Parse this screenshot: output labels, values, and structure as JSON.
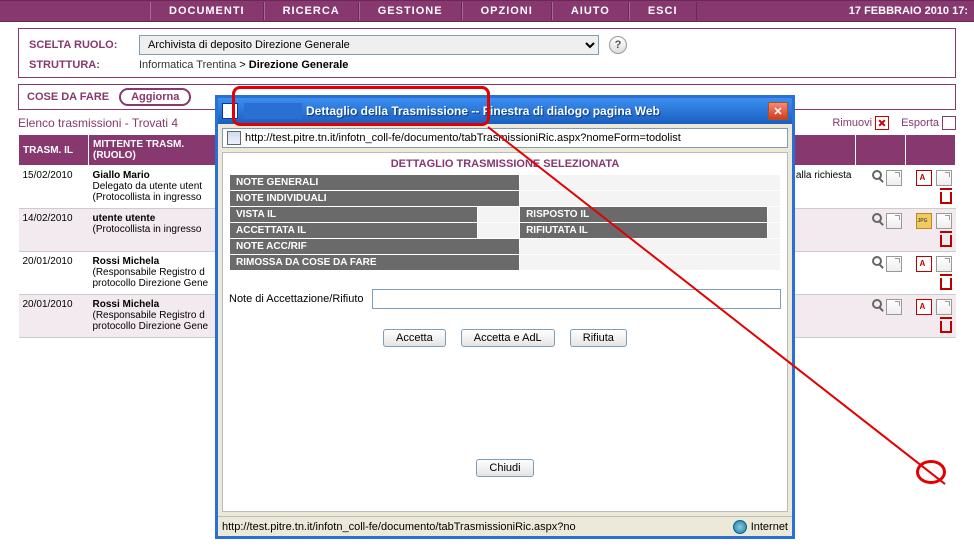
{
  "menu": {
    "items": [
      "DOCUMENTI",
      "RICERCA",
      "GESTIONE",
      "OPZIONI",
      "AIUTO",
      "ESCI"
    ],
    "date": "17 FEBBRAIO 2010 17:"
  },
  "role_panel": {
    "label_scelta": "SCELTA RUOLO:",
    "selected_role": "Archivista di deposito Direzione Generale",
    "label_struttura": "STRUTTURA:",
    "breadcrumb": {
      "item1": "Informatica Trentina",
      "sep": " > ",
      "item2": "Direzione Generale"
    },
    "help": "?"
  },
  "todo": {
    "label": "COSE DA FARE",
    "button": "Aggiorna"
  },
  "list": {
    "title": "Elenco trasmissioni - Trovati 4",
    "action_rimuovi": "Rimuovi",
    "action_esporta": "Esporta",
    "col_trasm": "TRASM. IL",
    "col_mittente": "MITTENTE TRASM. (RUOLO)"
  },
  "rows": [
    {
      "date": "15/02/2010",
      "mitt_name": "Giallo Mario",
      "mitt_role1": "Delegato da utente utent",
      "mitt_role2": "(Protocollista in ingresso",
      "rightnote": "uito alla richiesta"
    },
    {
      "date": "14/02/2010",
      "mitt_name": "utente utente",
      "mitt_role1": "(Protocollista in ingresso",
      "mitt_role2": ""
    },
    {
      "date": "20/01/2010",
      "mitt_name": "Rossi Michela",
      "mitt_role1": "(Responsabile Registro d",
      "mitt_role2": "protocollo Direzione Gene"
    },
    {
      "date": "20/01/2010",
      "mitt_name": "Rossi Michela",
      "mitt_role1": "(Responsabile Registro d",
      "mitt_role2": "protocollo Direzione Gene"
    }
  ],
  "dialog": {
    "title": "Dettaglio della Trasmissione -- Finestra di dialogo pagina Web",
    "url": "http://test.pitre.tn.it/infotn_coll-fe/documento/tabTrasmissioniRic.aspx?nomeForm=todolist",
    "section_title": "DETTAGLIO TRASMISSIONE SELEZIONATA",
    "labels": {
      "note_gen": "NOTE GENERALI",
      "note_ind": "NOTE INDIVIDUALI",
      "vista": "VISTA IL",
      "risposto": "RISPOSTO IL",
      "accettata": "ACCETTATA IL",
      "rifiutata": "RIFIUTATA IL",
      "note_accrif": "NOTE ACC/RIF",
      "rimossa": "RIMOSSA DA COSE DA FARE"
    },
    "note_input_label": "Note di Accettazione/Rifiuto",
    "btn_accetta": "Accetta",
    "btn_accetta_adl": "Accetta e AdL",
    "btn_rifiuta": "Rifiuta",
    "btn_chiudi": "Chiudi",
    "status_url": "http://test.pitre.tn.it/infotn_coll-fe/documento/tabTrasmissioniRic.aspx?no",
    "status_zone": "Internet"
  }
}
